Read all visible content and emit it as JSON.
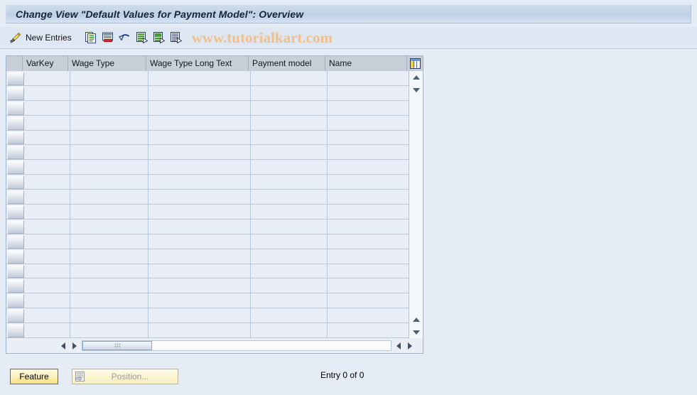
{
  "window": {
    "title": "Change View \"Default Values for Payment Model\": Overview"
  },
  "toolbar": {
    "display_change_icon": "pencil-icon",
    "new_entries_label": "New Entries",
    "buttons": [
      {
        "name": "copy-as-button",
        "icon": "copy-icon"
      },
      {
        "name": "delete-button",
        "icon": "delete-row-icon"
      },
      {
        "name": "undo-button",
        "icon": "undo-arrow-icon"
      },
      {
        "name": "select-all-button",
        "icon": "select-all-icon"
      },
      {
        "name": "deselect-all-button",
        "icon": "deselect-all-icon"
      },
      {
        "name": "select-block-button",
        "icon": "select-block-icon"
      }
    ],
    "watermark": "www.tutorialkart.com",
    "watermark_color": "#f0c08a"
  },
  "table": {
    "columns": [
      {
        "label": "VarKey",
        "width": 64
      },
      {
        "label": "Wage Type",
        "width": 110
      },
      {
        "label": "Wage Type Long Text",
        "width": 144
      },
      {
        "label": "Payment model",
        "width": 108
      },
      {
        "label": "Name",
        "width": 115
      }
    ],
    "config_icon": "column-config-icon",
    "rows": [],
    "row_count": 18,
    "scroll": {
      "up_icon": "scroll-up-icon",
      "down_icon": "scroll-down-icon",
      "left_icon": "scroll-left-icon",
      "right_icon": "scroll-right-icon"
    }
  },
  "footer": {
    "feature_label": "Feature",
    "position_label": "Position...",
    "position_icon": "position-icon",
    "entry_status": "Entry 0 of 0"
  },
  "colors": {
    "page_background": "#e6ecf5",
    "titlebar": "#c3d4e8",
    "header_row": "#c8cfd9",
    "cell_background": "#e9eef6",
    "grid_line": "#bcc8d8",
    "feature_button": "#f8e79a"
  }
}
